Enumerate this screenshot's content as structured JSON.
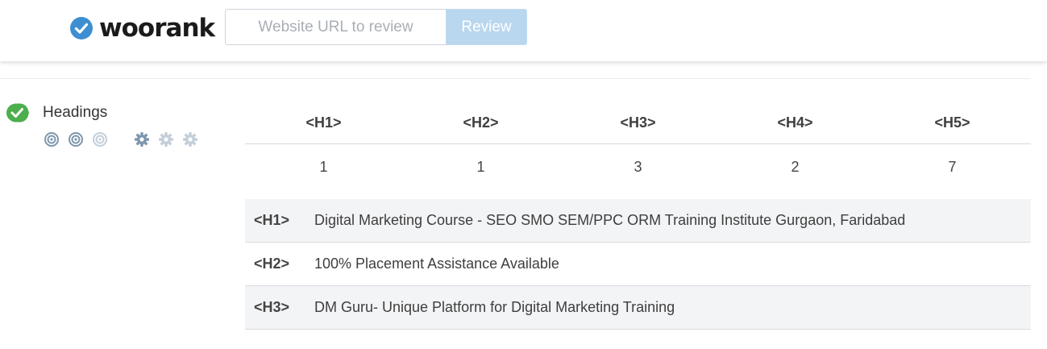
{
  "header": {
    "logo_text": "woorank",
    "url_placeholder": "Website URL to review",
    "review_label": "Review"
  },
  "section": {
    "title": "Headings",
    "status_icon": "check-icon",
    "rating_icons": [
      "target-icon",
      "target-icon",
      "target-icon-faded"
    ],
    "difficulty_icons": [
      "gear-icon",
      "gear-icon-faded",
      "gear-icon-faded"
    ]
  },
  "counts": {
    "headers": [
      "<H1>",
      "<H2>",
      "<H3>",
      "<H4>",
      "<H5>"
    ],
    "values": [
      "1",
      "1",
      "3",
      "2",
      "7"
    ]
  },
  "headings": [
    {
      "tag": "<H1>",
      "text": "Digital Marketing Course - SEO SMO SEM/PPC ORM Training Institute Gurgaon, Faridabad"
    },
    {
      "tag": "<H2>",
      "text": "100% Placement Assistance Available"
    },
    {
      "tag": "<H3>",
      "text": "DM Guru- Unique Platform for Digital Marketing Training"
    }
  ],
  "colors": {
    "brand_blue": "#3d8fd1",
    "button_disabled": "#b9d7ef",
    "check_green": "#4cae4c",
    "icon_gray": "#7e97ad",
    "icon_faded": "#c3ced8"
  }
}
